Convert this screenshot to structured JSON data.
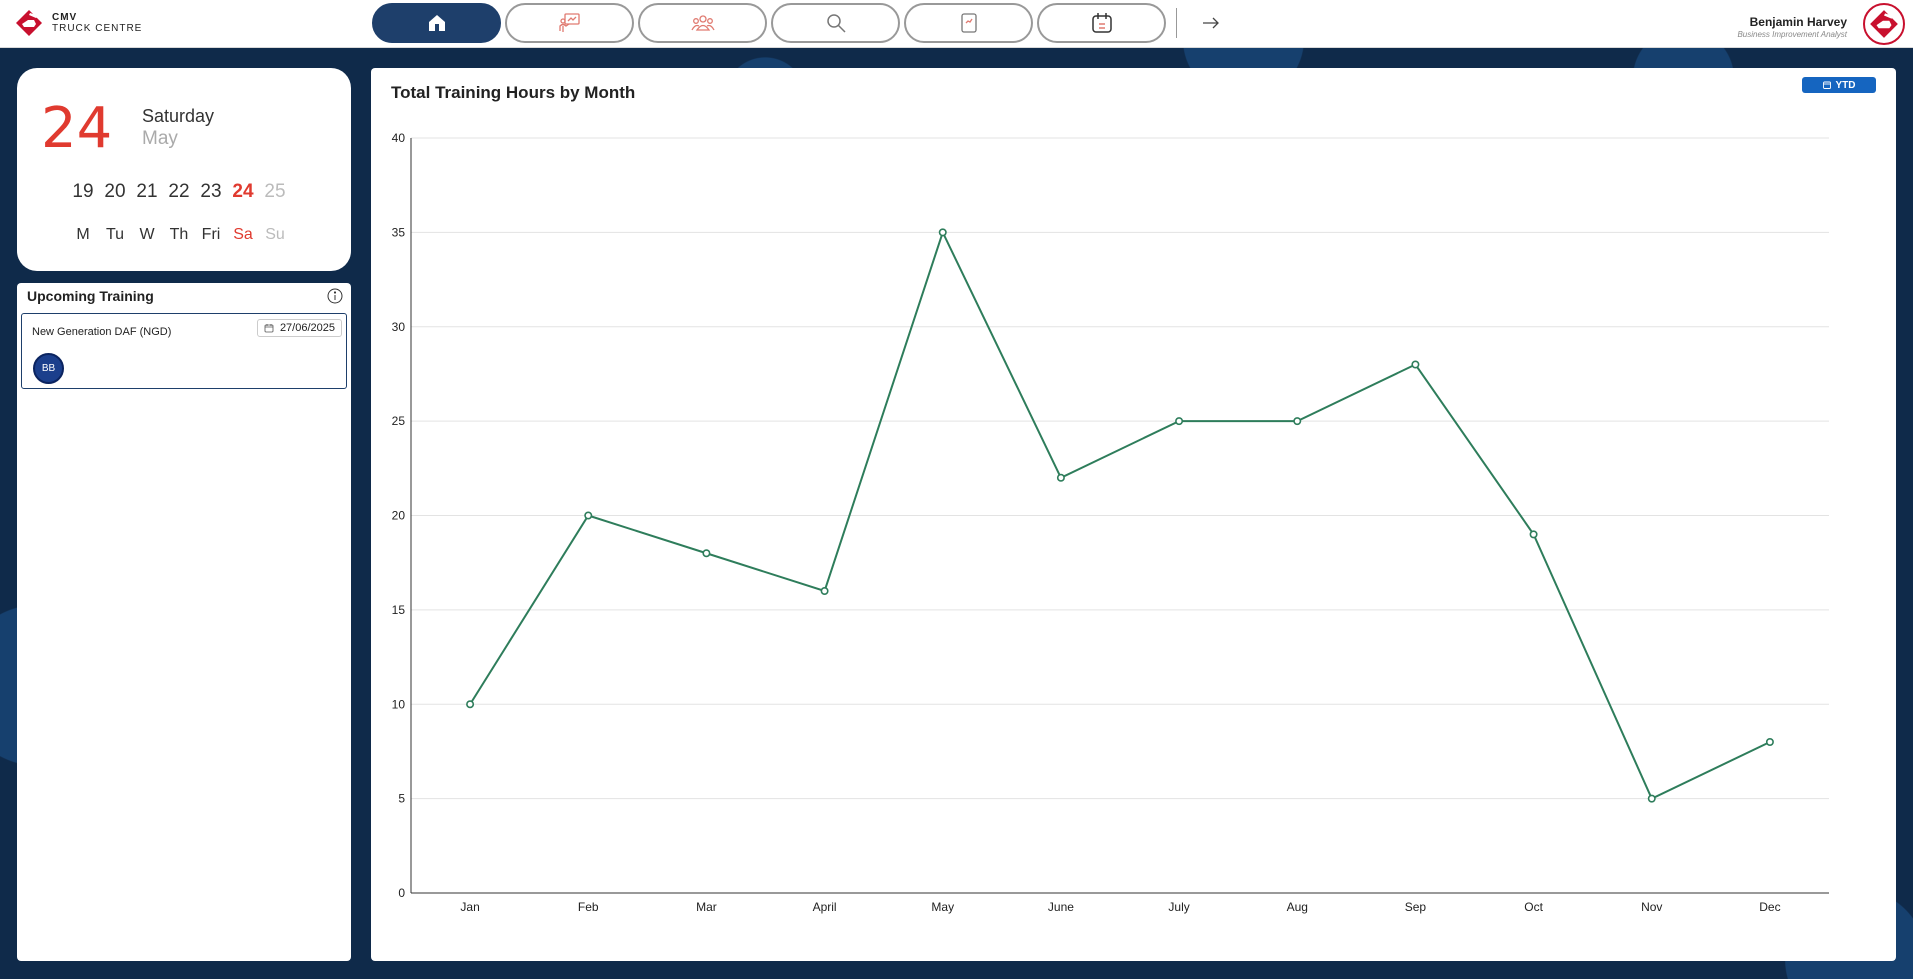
{
  "brand": {
    "line1": "CMV",
    "line2": "TRUCK CENTRE",
    "color": "#c8102e"
  },
  "nav": {
    "items": [
      {
        "icon": "home-icon",
        "active": true
      },
      {
        "icon": "training-presentation-icon",
        "active": false
      },
      {
        "icon": "people-icon",
        "active": false
      },
      {
        "icon": "search-icon",
        "active": false
      },
      {
        "icon": "trend-chart-icon",
        "active": false
      },
      {
        "icon": "calendar-icon",
        "active": false
      }
    ],
    "exit_icon": "arrow-right-icon"
  },
  "user": {
    "name": "Benjamin Harvey",
    "role": "Business Improvement Analyst"
  },
  "date_card": {
    "day": "24",
    "weekday": "Saturday",
    "month": "May",
    "days": [
      "19",
      "20",
      "21",
      "22",
      "23",
      "24",
      "25"
    ],
    "weekdays": [
      "M",
      "Tu",
      "W",
      "Th",
      "Fri",
      "Sa",
      "Su"
    ],
    "current_index": 5
  },
  "upcoming": {
    "title": "Upcoming Training",
    "items": [
      {
        "name": "New Generation DAF (NGD)",
        "date": "27/06/2025",
        "attendee_initials": "BB"
      }
    ]
  },
  "chart_panel": {
    "ytd_label": "YTD"
  },
  "colors": {
    "accent": "#e03a2f",
    "navy": "#1e3f6b",
    "line": "#2e7d5b",
    "ytd": "#1565c0"
  },
  "chart_data": {
    "type": "line",
    "title": "Total Training Hours by Month",
    "categories": [
      "Jan",
      "Feb",
      "Mar",
      "April",
      "May",
      "June",
      "July",
      "Aug",
      "Sep",
      "Oct",
      "Nov",
      "Dec"
    ],
    "series": [
      {
        "values": [
          10,
          20,
          18,
          16,
          35,
          22,
          25,
          25,
          28,
          19,
          5,
          8
        ]
      }
    ],
    "ylim": [
      0,
      40
    ],
    "yticks": [
      0,
      5,
      10,
      15,
      20,
      25,
      30,
      35,
      40
    ],
    "grid": true,
    "xlabel": "",
    "ylabel": ""
  }
}
